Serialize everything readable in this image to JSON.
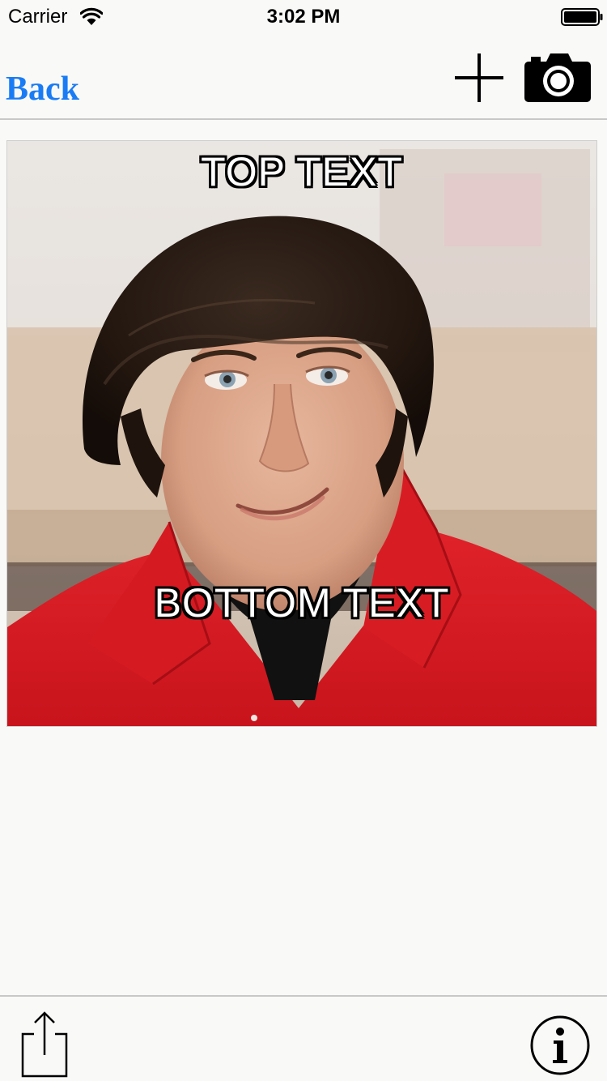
{
  "status_bar": {
    "carrier": "Carrier",
    "time": "3:02 PM",
    "wifi_icon": "wifi-icon",
    "battery_icon": "battery-full-icon"
  },
  "nav_bar": {
    "back_label": "Back",
    "add_icon": "plus-icon",
    "camera_icon": "camera-icon",
    "accent_color": "#1a7cf5"
  },
  "meme": {
    "top_text": "TOP TEXT",
    "bottom_text": "BOTTOM TEXT"
  },
  "toolbar": {
    "share_icon": "share-icon",
    "info_icon": "info-icon"
  }
}
